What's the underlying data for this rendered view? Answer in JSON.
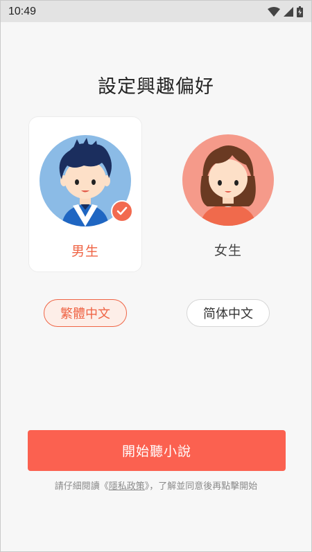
{
  "status_bar": {
    "time": "10:49",
    "icons": [
      "wifi-icon",
      "signal-icon",
      "battery-icon"
    ]
  },
  "title": "設定興趣偏好",
  "genders": [
    {
      "label": "男生",
      "selected": true,
      "avatar": "boy-avatar"
    },
    {
      "label": "女生",
      "selected": false,
      "avatar": "girl-avatar"
    }
  ],
  "languages": [
    {
      "label": "繁體中文",
      "selected": true
    },
    {
      "label": "简体中文",
      "selected": false
    }
  ],
  "start_button": "開始聽小說",
  "consent": {
    "prefix": "請仔細閱讀《",
    "link": "隱私政策",
    "suffix": "》，了解並同意後再點擊開始"
  },
  "colors": {
    "accent": "#ef6445",
    "button": "#fb6150",
    "male_bg": "#8bbbe6",
    "female_bg": "#f59a8a"
  }
}
